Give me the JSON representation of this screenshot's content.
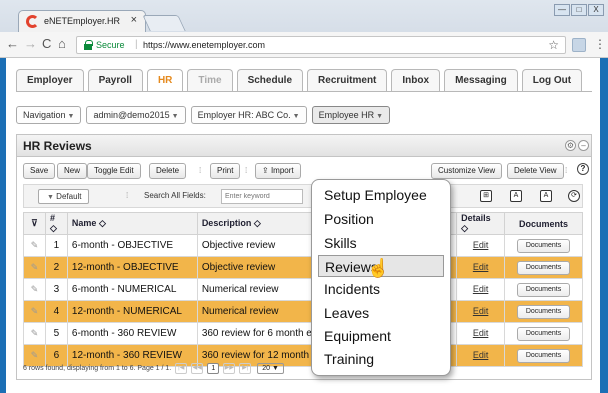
{
  "browser": {
    "tab_title": "eNETEmployer.HR",
    "tab_close": "×",
    "secure_label": "Secure",
    "url": "https://www.enetemployer.com",
    "window_controls": [
      "—",
      "□",
      "X"
    ]
  },
  "main_tabs": [
    {
      "label": "Employer",
      "state": "normal"
    },
    {
      "label": "Payroll",
      "state": "normal"
    },
    {
      "label": "HR",
      "state": "active"
    },
    {
      "label": "Time",
      "state": "disabled"
    },
    {
      "label": "Schedule",
      "state": "normal"
    },
    {
      "label": "Recruitment",
      "state": "normal"
    },
    {
      "label": "Inbox",
      "state": "normal"
    },
    {
      "label": "Messaging",
      "state": "normal"
    },
    {
      "label": "Log Out",
      "state": "normal"
    }
  ],
  "selectors": {
    "navigation": "Navigation",
    "user": "admin@demo2015",
    "employer": "Employer HR: ABC Co.",
    "employee": "Employee HR"
  },
  "panel": {
    "title": "HR Reviews"
  },
  "toolbar": {
    "save": "Save",
    "new": "New",
    "toggle_edit": "Toggle Edit",
    "delete": "Delete",
    "print": "Print",
    "import": "Import",
    "customize_view": "Customize View",
    "delete_view": "Delete View",
    "help": "?"
  },
  "filter": {
    "default": "Default",
    "search_label": "Search All Fields:",
    "placeholder": "Enter keyword"
  },
  "table": {
    "headers": {
      "num": "#",
      "name": "Name",
      "description": "Description",
      "details": "Details",
      "documents": "Documents"
    },
    "sort_icon": "◇",
    "rows": [
      {
        "num": "1",
        "name": "6-month - OBJECTIVE",
        "description": "Objective review",
        "details": "Edit",
        "documents": "Documents",
        "highlight": false
      },
      {
        "num": "2",
        "name": "12-month - OBJECTIVE",
        "description": "Objective review",
        "details": "Edit",
        "documents": "Documents",
        "highlight": true
      },
      {
        "num": "3",
        "name": "6-month - NUMERICAL",
        "description": "Numerical review",
        "details": "Edit",
        "documents": "Documents",
        "highlight": false
      },
      {
        "num": "4",
        "name": "12-month - NUMERICAL",
        "description": "Numerical review",
        "details": "Edit",
        "documents": "Documents",
        "highlight": true
      },
      {
        "num": "5",
        "name": "6-month - 360 REVIEW",
        "description": "360 review for 6 month employees",
        "details": "Edit",
        "documents": "Documents",
        "highlight": false
      },
      {
        "num": "6",
        "name": "12-month - 360 REVIEW",
        "description": "360 review for 12 month employees",
        "details": "Edit",
        "documents": "Documents",
        "highlight": true
      }
    ]
  },
  "pager": {
    "summary": "6 rows found, displaying from 1 to 6. Page 1 / 1.",
    "current_page": "1",
    "page_size": "20"
  },
  "dropdown": {
    "items": [
      "Setup Employee",
      "Position",
      "Skills",
      "Reviews",
      "Incidents",
      "Leaves",
      "Equipment",
      "Training"
    ],
    "hovered": "Reviews"
  },
  "colors": {
    "highlight_row": "#f2b54a",
    "active_tab": "#e58a1e",
    "secure": "#0a8a3a",
    "backdrop": "#1c6fb5"
  }
}
